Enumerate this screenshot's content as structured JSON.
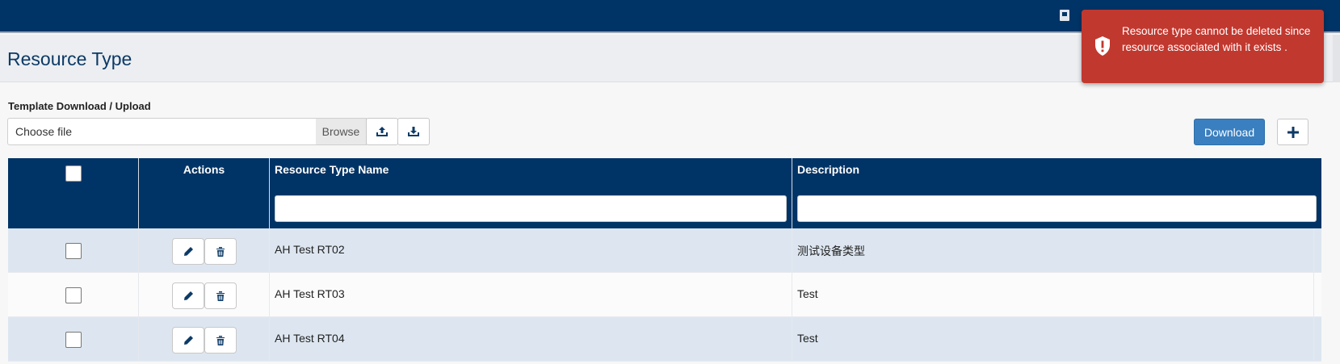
{
  "header": {
    "book_icon": "book-icon"
  },
  "page": {
    "title": "Resource Type"
  },
  "template": {
    "label": "Template Download / Upload",
    "file_placeholder": "Choose file",
    "browse_label": "Browse",
    "upload_icon": "upload-icon",
    "download_icon": "download-tray-icon"
  },
  "toolbar": {
    "download_label": "Download",
    "add_icon": "plus-icon"
  },
  "grid": {
    "columns": [
      "",
      "Actions",
      "Resource Type Name",
      "Description"
    ],
    "rows": [
      {
        "name": "AH Test RT02",
        "description": "测试设备类型"
      },
      {
        "name": "AH Test RT03",
        "description": "Test"
      },
      {
        "name": "AH Test RT04",
        "description": "Test"
      }
    ],
    "row_icons": {
      "edit": "pencil-icon",
      "delete": "trash-icon"
    }
  },
  "toast": {
    "message": "Resource type cannot be deleted since resource associated with it exists .",
    "color": "#c1382f",
    "icon": "alert-shield-icon"
  },
  "colors": {
    "header": "#013466",
    "accent": "#3a7fbf",
    "row_alt": "#dde6f0"
  }
}
